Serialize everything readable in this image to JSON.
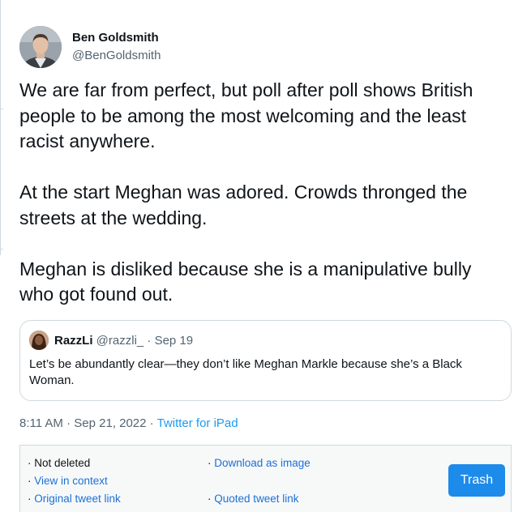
{
  "tweet": {
    "author": {
      "name": "Ben Goldsmith",
      "handle": "@BenGoldsmith"
    },
    "paragraphs": [
      "We are far from perfect, but poll after poll shows British people to be among the most welcoming and the least racist anywhere.",
      "At the start Meghan was adored. Crowds thronged the streets at the wedding.",
      "Meghan is disliked because she is a manipulative bully who got found out."
    ],
    "timestamp": "8:11 AM · Sep 21, 2022",
    "separator": " · ",
    "source": "Twitter for iPad"
  },
  "quote": {
    "name": "RazzLi",
    "meta": " @razzli_ · Sep 19",
    "text": "Let’s be abundantly clear—they don’t like Meghan Markle because she’s a Black Woman."
  },
  "footer": {
    "status": "Not deleted",
    "view_in_context": "View in context",
    "original_link": "Original tweet link",
    "download": "Download as image",
    "quoted_link": "Quoted tweet link",
    "bullet": "· ",
    "trash_label": "Trash"
  },
  "colors": {
    "link_blue": "#1d9bf0",
    "button_blue": "#1d8bea",
    "muted_text": "#536471",
    "border": "#cfd9de"
  }
}
